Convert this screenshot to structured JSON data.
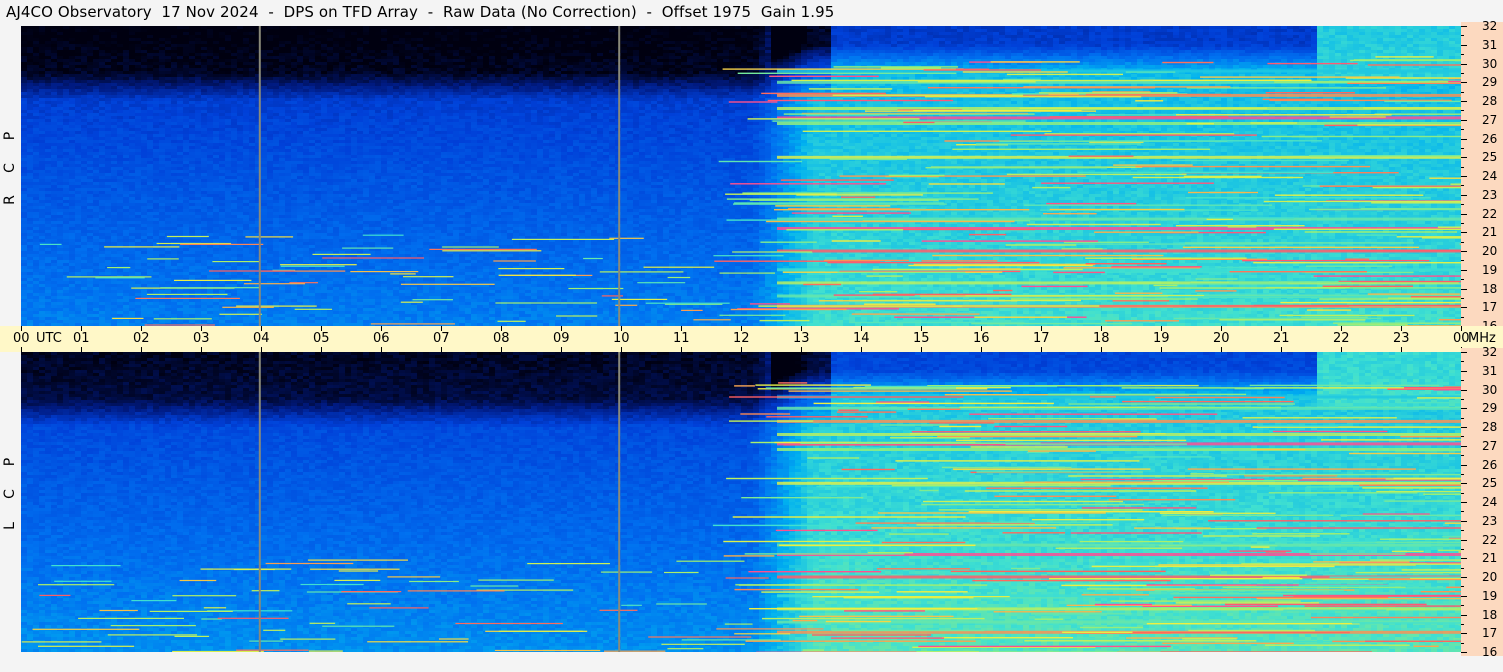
{
  "title": "AJ4CO Observatory  17 Nov 2024  -  DPS on TFD Array  -  Raw Data (No Correction)  -  Offset 1975  Gain 1.95",
  "chart_data": {
    "type": "heatmap",
    "x_unit_label": "UTC",
    "y_unit_label": "MHz",
    "x_ticks": [
      "00",
      "01",
      "02",
      "03",
      "04",
      "05",
      "06",
      "07",
      "08",
      "09",
      "10",
      "11",
      "12",
      "13",
      "14",
      "15",
      "16",
      "17",
      "18",
      "19",
      "20",
      "21",
      "22",
      "23",
      "00"
    ],
    "x_range_hours": [
      0,
      24
    ],
    "y_range_mhz": [
      16,
      32
    ],
    "y_ticks": [
      "32",
      "31",
      "30",
      "29",
      "28",
      "27",
      "26",
      "25",
      "24",
      "23",
      "22",
      "21",
      "20",
      "19",
      "18",
      "17",
      "16"
    ],
    "colormap": [
      "#000010",
      "#001a80",
      "#0040d8",
      "#0070f0",
      "#00b0f0",
      "#40e0d0",
      "#a0f070",
      "#f0f040",
      "#ff6060",
      "#ff40c0"
    ],
    "panels": [
      {
        "label_letters": [
          "R",
          "C",
          "P"
        ],
        "polarization": "RCP"
      },
      {
        "label_letters": [
          "L",
          "C",
          "P"
        ],
        "polarization": "LCP"
      }
    ],
    "vertical_markers_hours": [
      3.98,
      9.97
    ],
    "persistent_bands_mhz": [
      {
        "f": 17.05,
        "level": 0.85
      },
      {
        "f": 17.6,
        "level": 0.6
      },
      {
        "f": 18.3,
        "level": 0.7
      },
      {
        "f": 19.0,
        "level": 0.55
      },
      {
        "f": 20.0,
        "level": 0.9
      },
      {
        "f": 21.2,
        "level": 0.95
      },
      {
        "f": 21.7,
        "level": 0.6
      },
      {
        "f": 25.0,
        "level": 0.75
      },
      {
        "f": 26.8,
        "level": 0.65
      },
      {
        "f": 27.1,
        "level": 0.95
      },
      {
        "f": 27.6,
        "level": 0.7
      },
      {
        "f": 28.3,
        "level": 0.85
      },
      {
        "f": 29.0,
        "level": 0.6
      },
      {
        "f": 29.6,
        "level": 0.5
      }
    ]
  }
}
